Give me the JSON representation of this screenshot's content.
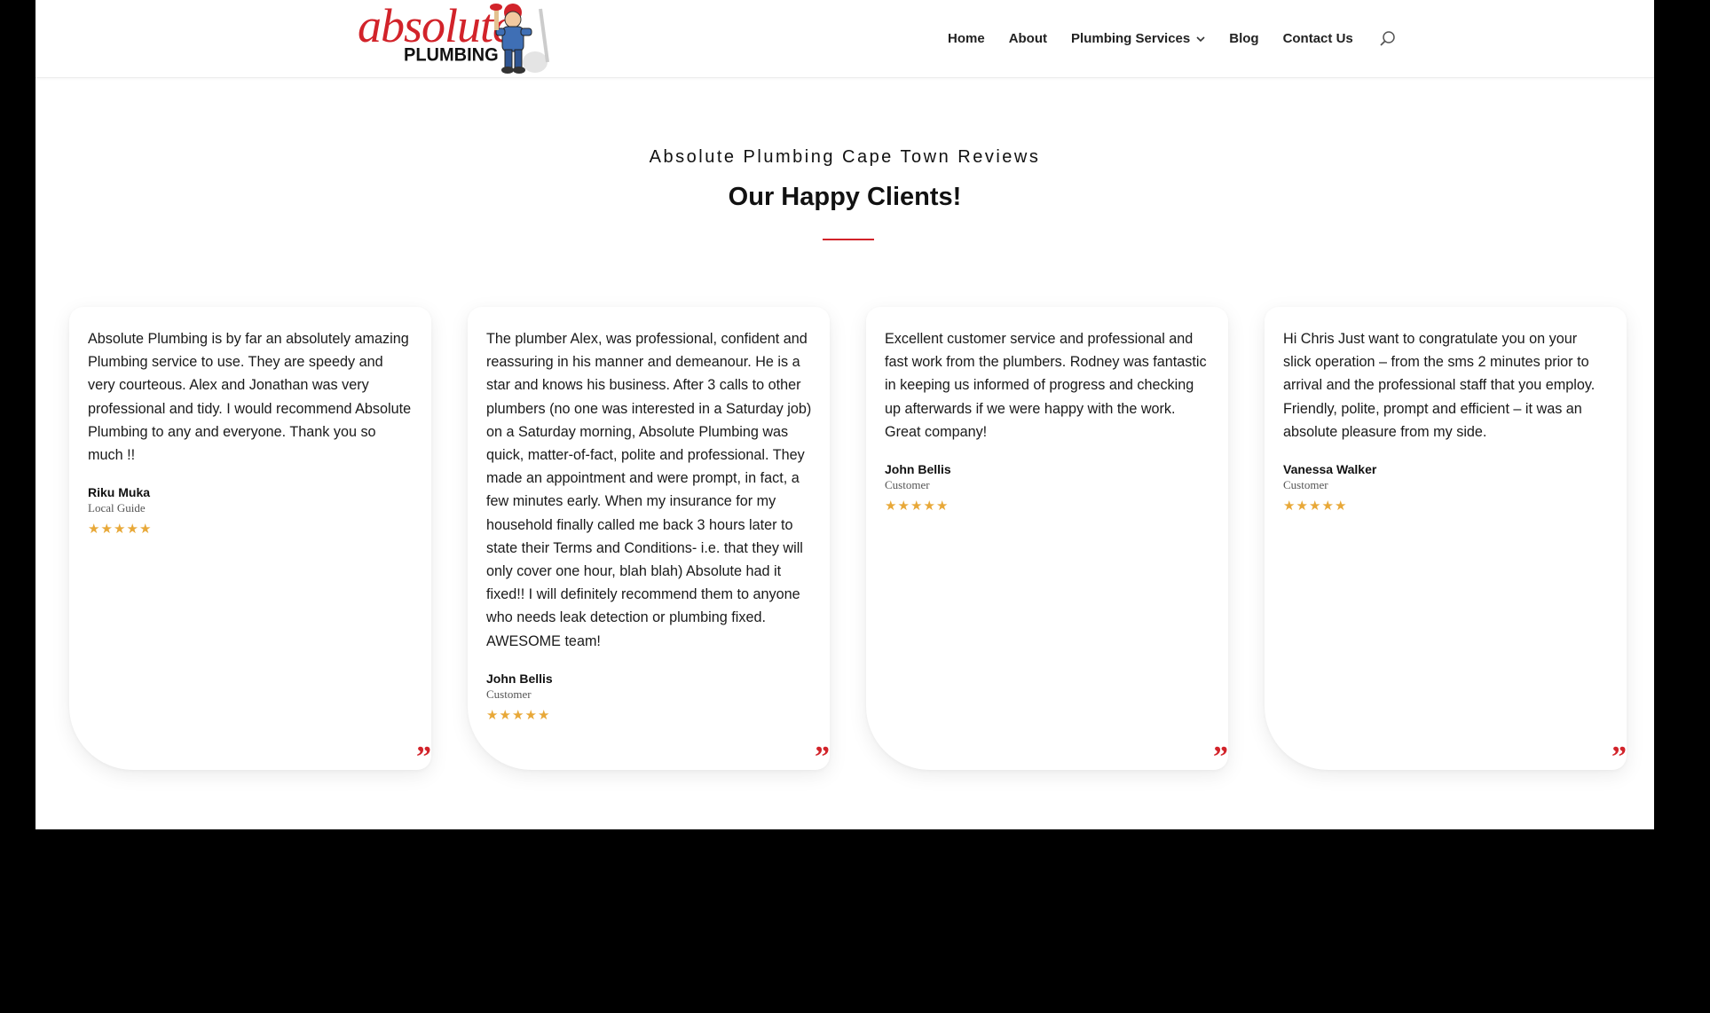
{
  "header": {
    "logo": {
      "script_text": "absolute",
      "block_text": "PLUMBING",
      "mascot_icon": "plumber-mascot-icon"
    },
    "nav": [
      {
        "label": "Home"
      },
      {
        "label": "About"
      },
      {
        "label": "Plumbing Services",
        "has_dropdown": true
      },
      {
        "label": "Blog"
      },
      {
        "label": "Contact Us"
      }
    ],
    "search_icon": "search-icon"
  },
  "reviews_section": {
    "eyebrow": "Absolute Plumbing Cape Town Reviews",
    "title": "Our Happy Clients!",
    "accent_color": "#d2232a",
    "star_color": "#e8a838",
    "reviews": [
      {
        "text": "Absolute Plumbing is by far an absolutely amazing Plumbing service to use. They are speedy and very courteous. Alex and Jonathan was very professional and tidy. I would recommend Absolute Plumbing to any and everyone. Thank you so much !!",
        "name": "Riku Muka",
        "role": "Local Guide",
        "rating": 5
      },
      {
        "text": "The plumber Alex, was professional, confident and reassuring in his manner and demeanour. He is a star and knows his business. After 3 calls to other plumbers (no one was interested in a Saturday job) on a Saturday morning, Absolute Plumbing was quick, matter-of-fact, polite and professional. They made an appointment and were prompt, in fact, a few minutes early. When my insurance for my household finally called me back 3 hours later to state their Terms and Conditions- i.e. that they will only cover one hour, blah blah) Absolute had it fixed!! I will definitely recommend them to anyone who needs leak detection or plumbing fixed. AWESOME team!",
        "name": "John Bellis",
        "role": "Customer",
        "rating": 5
      },
      {
        "text": "Excellent customer service and professional and fast work from the plumbers. Rodney was fantastic in keeping us informed of progress and checking up afterwards if we were happy with the work. Great company!",
        "name": "John Bellis",
        "role": "Customer",
        "rating": 5
      },
      {
        "text": "Hi Chris Just want to congratulate you on your slick operation – from the sms 2 minutes prior to arrival and the professional staff that you employ. Friendly, polite, prompt and efficient – it was an absolute pleasure from my side.",
        "name": "Vanessa Walker",
        "role": "Customer",
        "rating": 5
      }
    ]
  }
}
